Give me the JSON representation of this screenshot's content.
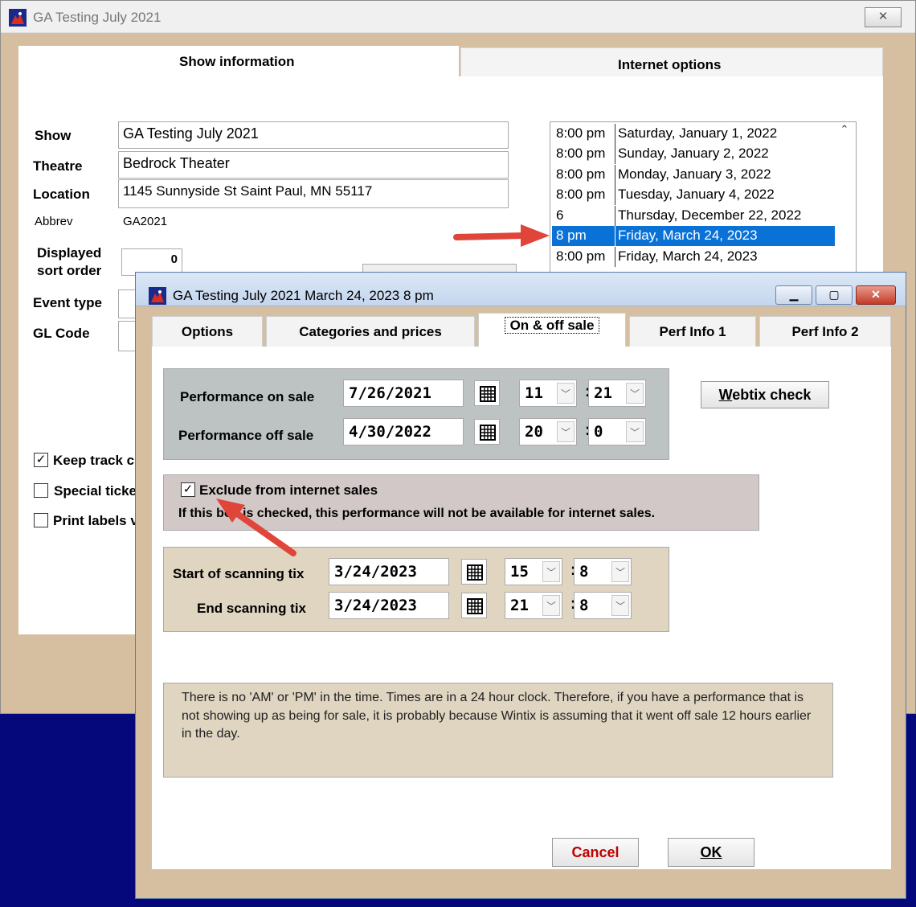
{
  "main_window": {
    "title": "GA Testing July 2021",
    "close_glyph": "✕",
    "tabs": [
      "Show information",
      "Internet options"
    ],
    "labels": {
      "show": "Show",
      "theatre": "Theatre",
      "location": "Location",
      "abbrev": "Abbrev",
      "sort1": "Displayed",
      "sort2": "sort order",
      "event_type": "Event type",
      "gl_code": "GL Code"
    },
    "values": {
      "show": "GA Testing July 2021",
      "theatre": "Bedrock Theater",
      "location": "1145 Sunnyside St Saint Paul, MN 55117",
      "abbrev": "GA2021",
      "sort_order": "0"
    },
    "checkboxes": [
      {
        "label": "Keep track c",
        "checked": true
      },
      {
        "label": "Special ticke",
        "checked": false
      },
      {
        "label": "Print labels v",
        "checked": false
      }
    ],
    "performances": [
      {
        "time": "8:00 pm",
        "date": "Saturday, January 1, 2022"
      },
      {
        "time": "8:00 pm",
        "date": "Sunday, January 2, 2022"
      },
      {
        "time": "8:00 pm",
        "date": "Monday, January 3, 2022"
      },
      {
        "time": "8:00 pm",
        "date": "Tuesday, January 4, 2022"
      },
      {
        "time": "6",
        "date": "Thursday, December 22, 2022"
      },
      {
        "time": "8 pm",
        "date": "Friday, March 24, 2023",
        "selected": true
      },
      {
        "time": "8:00 pm",
        "date": "Friday, March 24, 2023"
      }
    ]
  },
  "dialog": {
    "title": "GA Testing July 2021 March 24, 2023 8 pm",
    "tabs": [
      "Options",
      "Categories and prices",
      "On & off sale",
      "Perf Info 1",
      "Perf Info 2"
    ],
    "active_tab": "On & off sale",
    "on_sale_label": "Performance on sale",
    "on_sale_date": "7/26/2021",
    "on_sale_hour": "11",
    "on_sale_min": "21",
    "off_sale_label": "Performance off sale",
    "off_sale_date": "4/30/2022",
    "off_sale_hour": "20",
    "off_sale_min": "0",
    "webtix_prefix": "W",
    "webtix_rest": "ebtix check",
    "exclude_label": "Exclude from internet sales",
    "exclude_checked": true,
    "exclude_note": "If this box is checked, this performance will not be available for internet sales.",
    "start_scan_label": "Start of scanning tix",
    "start_scan_date": "3/24/2023",
    "start_scan_hour": "15",
    "start_scan_min": "8",
    "end_scan_label": "End scanning tix",
    "end_scan_date": "3/24/2023",
    "end_scan_hour": "21",
    "end_scan_min": "8",
    "info_note": "There is no 'AM' or 'PM' in the time. Times are in a 24 hour clock. Therefore, if you have a performance that is not showing up as being for sale, it is probably because Wintix is assuming that it went off sale 12 hours earlier in the day.",
    "cancel_label": "Cancel",
    "ok_label": "OK",
    "colors": {
      "cancel_text": "#c00000",
      "selection": "#0a72d6",
      "arrow": "#e0453a"
    }
  }
}
